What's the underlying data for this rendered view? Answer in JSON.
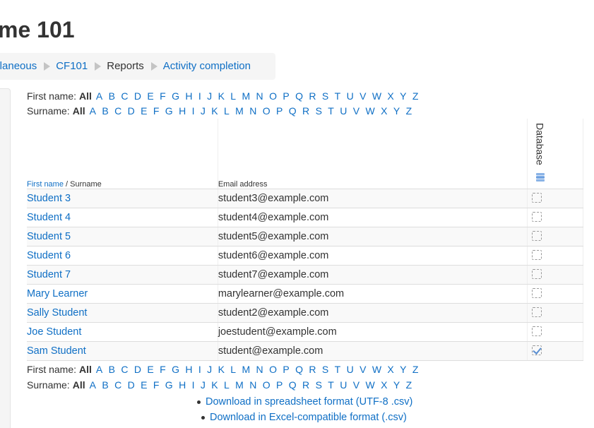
{
  "page": {
    "title": "me 101"
  },
  "breadcrumb": {
    "items": [
      "ellaneous",
      "CF101",
      "Reports",
      "Activity completion"
    ]
  },
  "initials": {
    "first_name_label": "First name:",
    "surname_label": "Surname:",
    "all_label": "All",
    "letters": [
      "A",
      "B",
      "C",
      "D",
      "E",
      "F",
      "G",
      "H",
      "I",
      "J",
      "K",
      "L",
      "M",
      "N",
      "O",
      "P",
      "Q",
      "R",
      "S",
      "T",
      "U",
      "V",
      "W",
      "X",
      "Y",
      "Z"
    ]
  },
  "table": {
    "header": {
      "first_name": "First name",
      "separator": " / ",
      "surname": "Surname",
      "email": "Email address",
      "activity": "Database",
      "activity_icon": "database-icon"
    },
    "rows": [
      {
        "name": "Student 3",
        "email": "student3@example.com",
        "completed": false
      },
      {
        "name": "Student 4",
        "email": "student4@example.com",
        "completed": false
      },
      {
        "name": "Student 5",
        "email": "student5@example.com",
        "completed": false
      },
      {
        "name": "Student 6",
        "email": "student6@example.com",
        "completed": false
      },
      {
        "name": "Student 7",
        "email": "student7@example.com",
        "completed": false
      },
      {
        "name": "Mary Learner",
        "email": "marylearner@example.com",
        "completed": false
      },
      {
        "name": "Sally Student",
        "email": "student2@example.com",
        "completed": false
      },
      {
        "name": "Joe Student",
        "email": "joestudent@example.com",
        "completed": false
      },
      {
        "name": "Sam Student",
        "email": "student@example.com",
        "completed": true
      }
    ]
  },
  "downloads": {
    "utf8": "Download in spreadsheet format (UTF-8 .csv)",
    "excel": "Download in Excel-compatible format (.csv)"
  },
  "colors": {
    "link": "#0f6fc5",
    "text": "#333333",
    "breadcrumb_bg": "#f5f5f5",
    "check_mark": "#5b8fd1"
  }
}
